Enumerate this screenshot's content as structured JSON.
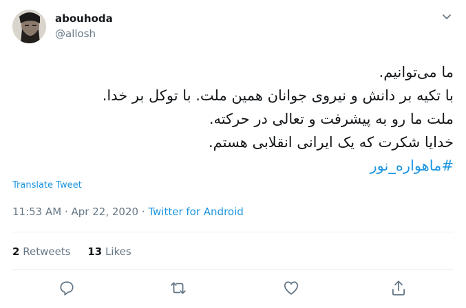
{
  "user": {
    "display_name": "abouhoda",
    "handle": "@allosh"
  },
  "tweet": {
    "lines": [
      "ما می‌توانیم.",
      "با تکیه بر دانش و نیروی جوانان همین ملت. با توکل بر خدا.",
      "ملت ما رو به پیشرفت و تعالی در حرکته.",
      "خدایا شکرت که یک ایرانی انقلابی هستم."
    ],
    "hashtag": "#ماهواره_نور"
  },
  "translate_label": "Translate Tweet",
  "meta": {
    "time": "11:53 AM",
    "separator": " · ",
    "date": "Apr 22, 2020",
    "source": "Twitter for Android"
  },
  "stats": {
    "retweets_count": "2",
    "retweets_label": "Retweets",
    "likes_count": "13",
    "likes_label": "Likes"
  },
  "icons": {
    "menu": "chevron-down-icon",
    "reply": "reply-icon",
    "retweet": "retweet-icon",
    "like": "heart-icon",
    "share": "share-icon"
  },
  "colors": {
    "link": "#1b95e0",
    "secondary_text": "#657786",
    "primary_text": "#14171a",
    "divider": "#e6ecf0"
  }
}
